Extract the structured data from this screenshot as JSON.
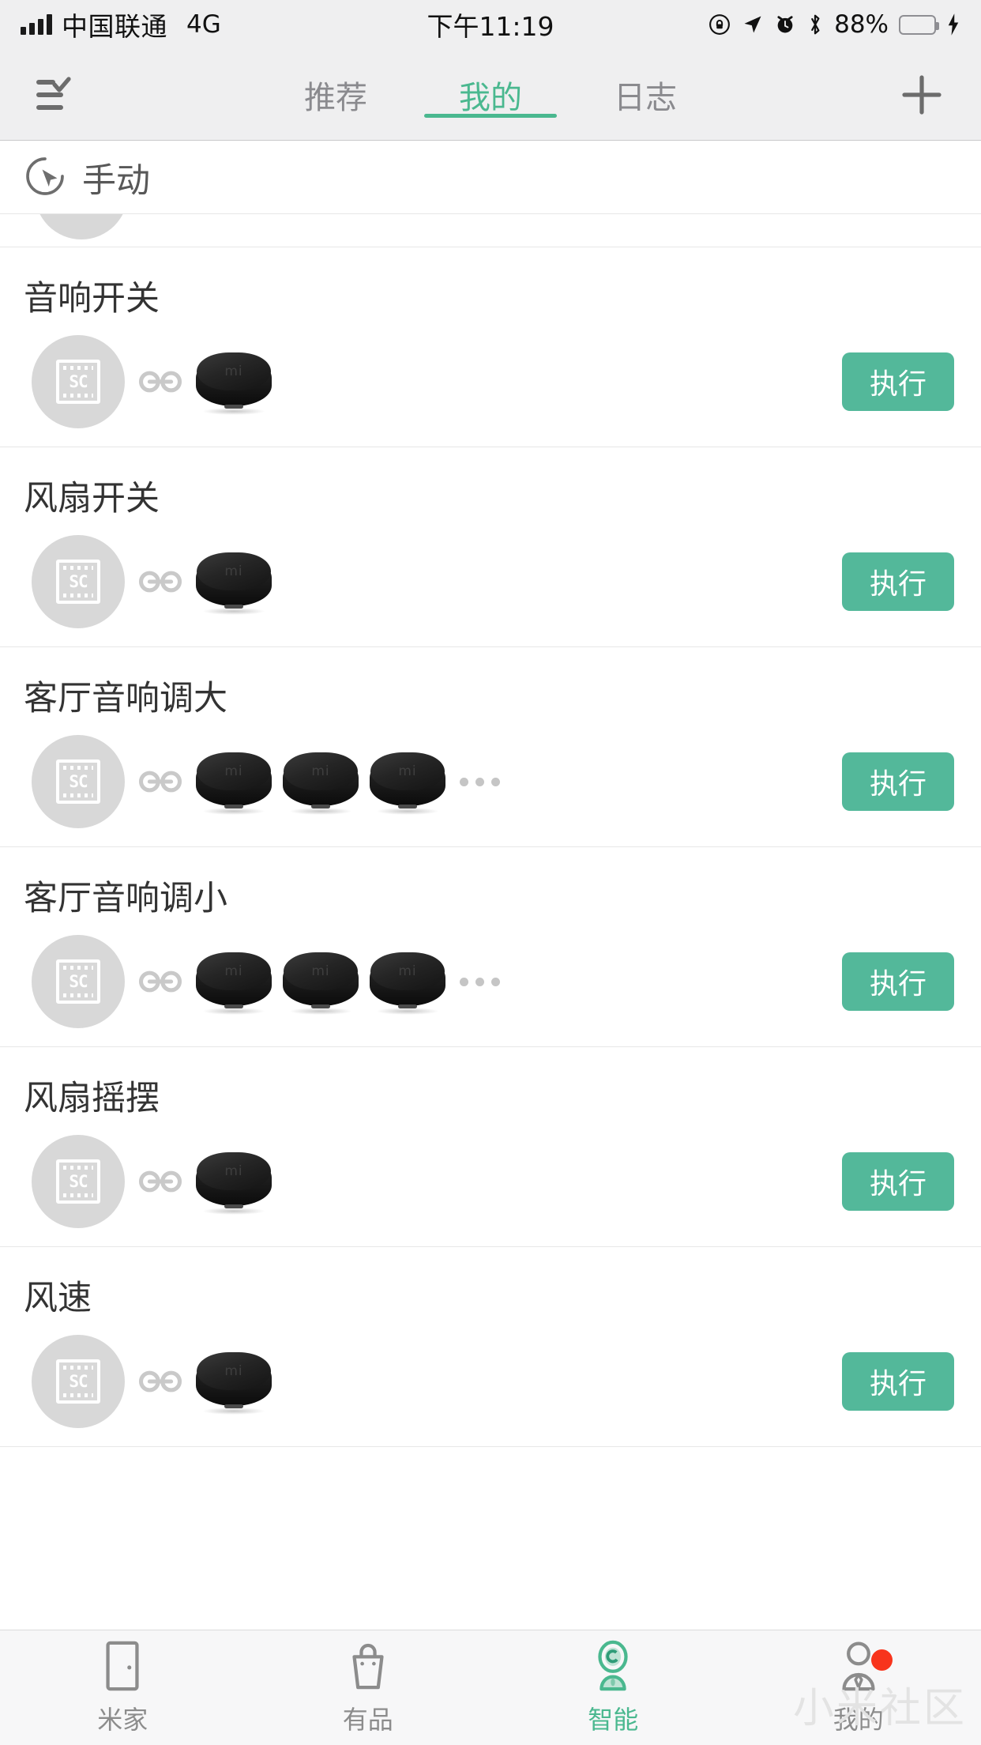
{
  "status_bar": {
    "carrier": "中国联通",
    "network": "4G",
    "time": "下午11:19",
    "battery_percent": "88%",
    "battery_level": 88,
    "icons": [
      "signal-icon",
      "rotation-lock-icon",
      "location-arrow-icon",
      "alarm-clock-icon",
      "bluetooth-icon",
      "battery-icon",
      "charging-bolt-icon"
    ]
  },
  "top_bar": {
    "menu_icon": "checklist-icon",
    "add_icon": "plus-icon",
    "tabs": [
      {
        "label": "推荐",
        "active": false
      },
      {
        "label": "我的",
        "active": true
      },
      {
        "label": "日志",
        "active": false
      }
    ]
  },
  "section": {
    "title": "手动",
    "icon": "cursor-circle-icon"
  },
  "scenes": [
    {
      "title": "音响开关",
      "scene_icon_label": "SC",
      "device_count": 1,
      "has_more": false,
      "action_label": "执行"
    },
    {
      "title": "风扇开关",
      "scene_icon_label": "SC",
      "device_count": 1,
      "has_more": false,
      "action_label": "执行"
    },
    {
      "title": "客厅音响调大",
      "scene_icon_label": "SC",
      "device_count": 3,
      "has_more": true,
      "action_label": "执行"
    },
    {
      "title": "客厅音响调小",
      "scene_icon_label": "SC",
      "device_count": 3,
      "has_more": true,
      "action_label": "执行"
    },
    {
      "title": "风扇摇摆",
      "scene_icon_label": "SC",
      "device_count": 1,
      "has_more": false,
      "action_label": "执行"
    },
    {
      "title": "风速",
      "scene_icon_label": "SC",
      "device_count": 1,
      "has_more": false,
      "action_label": "执行"
    }
  ],
  "bottom_nav": [
    {
      "label": "米家",
      "icon": "door-icon",
      "active": false,
      "badge": false
    },
    {
      "label": "有品",
      "icon": "bag-icon",
      "active": false,
      "badge": false
    },
    {
      "label": "智能",
      "icon": "robot-icon",
      "active": true,
      "badge": false
    },
    {
      "label": "我的",
      "icon": "person-icon",
      "active": false,
      "badge": true
    }
  ],
  "watermark": "小米社区",
  "colors": {
    "accent": "#4ab88f",
    "button": "#53b89a",
    "bar_bg": "#efeff0",
    "badge": "#f8341c",
    "battery": "#66d472"
  }
}
